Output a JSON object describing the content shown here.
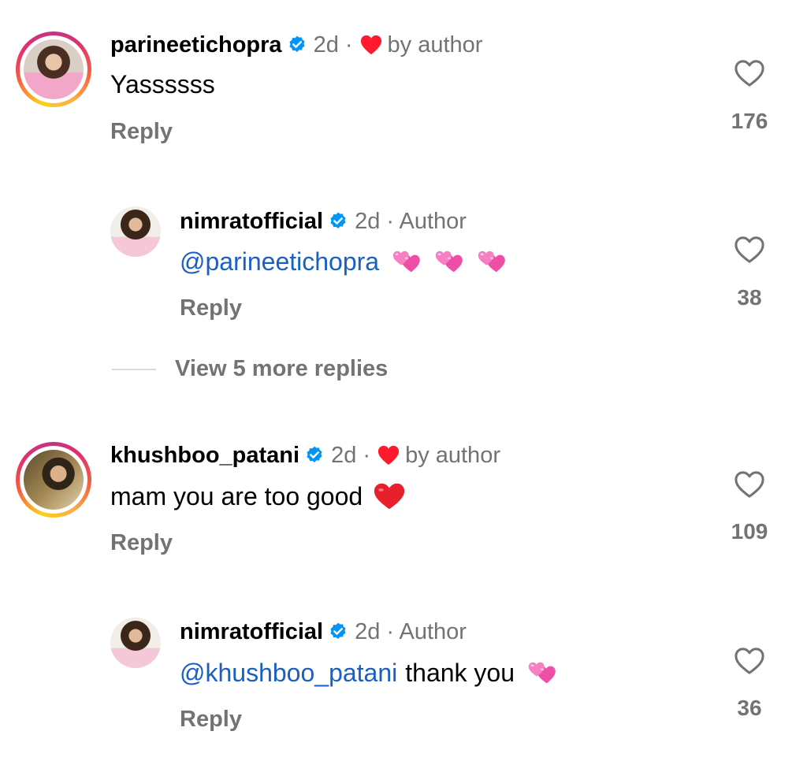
{
  "comments": [
    {
      "username": "parineetichopra",
      "time": "2d ·",
      "liked_by": "by author",
      "text": "Yassssss",
      "reply_label": "Reply",
      "likes": "176",
      "replies": [
        {
          "username": "nimratofficial",
          "time": "2d · Author",
          "mention": "@parineetichopra",
          "text": "",
          "emoji": [
            "two-hearts",
            "two-hearts",
            "two-hearts"
          ],
          "reply_label": "Reply",
          "likes": "38"
        }
      ],
      "view_more": "View 5 more replies"
    },
    {
      "username": "khushboo_patani",
      "time": "2d ·",
      "liked_by": "by author",
      "text": "mam you are too good",
      "emoji": [
        "red-heart"
      ],
      "reply_label": "Reply",
      "likes": "109",
      "replies": [
        {
          "username": "nimratofficial",
          "time": "2d · Author",
          "mention": "@khushboo_patani",
          "text": "thank you",
          "emoji": [
            "two-hearts"
          ],
          "reply_label": "Reply",
          "likes": "36"
        }
      ]
    }
  ],
  "colors": {
    "verified_blue": "#0095f6",
    "mention_blue": "#1a5fc4",
    "secondary_gray": "#737373",
    "heart_red": "#ff3040",
    "emoji_pink": "#f060b0"
  }
}
